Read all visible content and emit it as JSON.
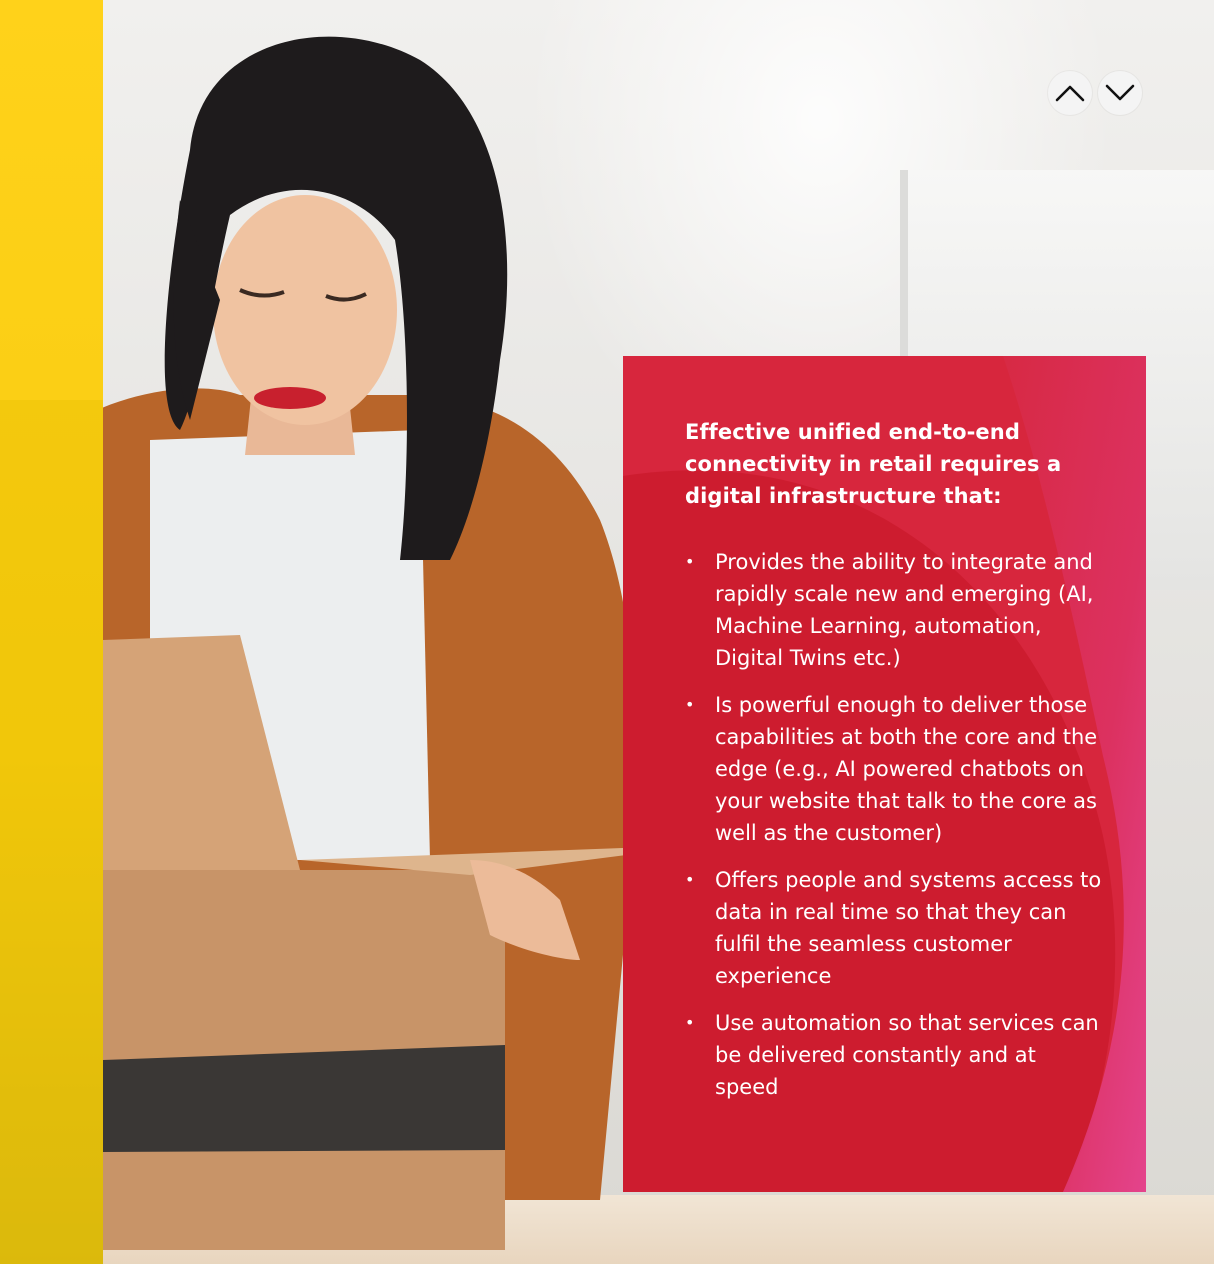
{
  "navigation": {
    "previous_icon": "chevron-up-icon",
    "next_icon": "chevron-down-icon"
  },
  "card": {
    "heading": "Effective unified end-to-end connectivity in retail requires a digital infrastructure that:",
    "bullet_symbol": "•",
    "items": [
      "Provides the ability to integrate and rapidly scale new and emerging (AI, Machine Learning, automation, Digital Twins etc.)",
      "Is powerful enough to deliver those capabilities at both the core and the edge (e.g., AI powered chatbots on your website that talk to the core as well as the customer)",
      "Offers people and systems access to data in real time so that they can fulfil the seamless customer experience",
      "Use automation so that services can be delivered constantly and at speed"
    ]
  },
  "colors": {
    "accent_yellow": "#ffd21a",
    "card_red": "#d7263d",
    "card_magenta": "#e0418a",
    "text_white": "#ffffff"
  }
}
